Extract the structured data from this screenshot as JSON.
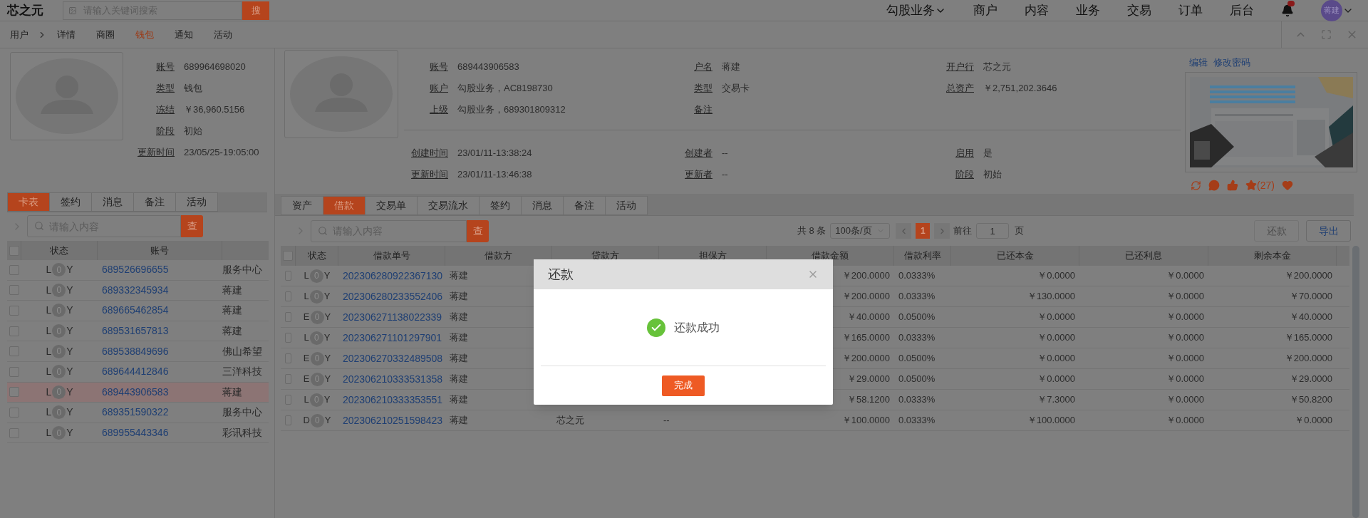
{
  "top_bar": {
    "logo": "芯之元",
    "search": {
      "placeholder": "请输入关键词搜索",
      "button": "搜"
    },
    "nav": [
      {
        "label": "勾股业务",
        "dropdown": true
      },
      {
        "label": "商户",
        "dropdown": false
      },
      {
        "label": "内容",
        "dropdown": false
      },
      {
        "label": "业务",
        "dropdown": false
      },
      {
        "label": "交易",
        "dropdown": false
      },
      {
        "label": "订单",
        "dropdown": false
      },
      {
        "label": "后台",
        "dropdown": false
      }
    ],
    "user": {
      "avatar": "蒋建"
    }
  },
  "breadcrumb": {
    "root": "用户",
    "tabs": [
      {
        "label": "详情",
        "selected": false
      },
      {
        "label": "商圈",
        "selected": false
      },
      {
        "label": "钱包",
        "selected": true
      },
      {
        "label": "通知",
        "selected": false
      },
      {
        "label": "活动",
        "selected": false
      }
    ]
  },
  "wallet": {
    "fields": [
      {
        "label": "账号",
        "value": "689964698020"
      },
      {
        "label": "类型",
        "value": "钱包"
      },
      {
        "label": "冻结",
        "value": "￥36,960.5156"
      },
      {
        "label": "阶段",
        "value": "初始"
      },
      {
        "label": "更新时间",
        "value": "23/05/25-19:05:00"
      }
    ]
  },
  "left_tabs": [
    {
      "label": "卡表",
      "selected": true
    },
    {
      "label": "签约",
      "selected": false
    },
    {
      "label": "消息",
      "selected": false
    },
    {
      "label": "备注",
      "selected": false
    },
    {
      "label": "活动",
      "selected": false
    }
  ],
  "left_search": {
    "placeholder": "请输入内容",
    "button": "查"
  },
  "left_table": {
    "all_checked": false,
    "columns": [
      "状态",
      "账号"
    ],
    "rows": [
      {
        "status": {
          "prefix": "L",
          "count": "0",
          "suffix": "Y"
        },
        "account": "689526696655",
        "column_3": "服务中心",
        "checked": false,
        "selected": false
      },
      {
        "status": {
          "prefix": "L",
          "count": "0",
          "suffix": "Y"
        },
        "account": "689332345934",
        "column_3": "蒋建",
        "checked": false,
        "selected": false
      },
      {
        "status": {
          "prefix": "L",
          "count": "0",
          "suffix": "Y"
        },
        "account": "689665462854",
        "column_3": "蒋建",
        "checked": false,
        "selected": false
      },
      {
        "status": {
          "prefix": "L",
          "count": "0",
          "suffix": "Y"
        },
        "account": "689531657813",
        "column_3": "蒋建",
        "checked": false,
        "selected": false
      },
      {
        "status": {
          "prefix": "L",
          "count": "0",
          "suffix": "Y"
        },
        "account": "689538849696",
        "column_3": "佛山希望",
        "checked": false,
        "selected": false
      },
      {
        "status": {
          "prefix": "L",
          "count": "0",
          "suffix": "Y"
        },
        "account": "689644412846",
        "column_3": "三洋科技",
        "checked": false,
        "selected": false
      },
      {
        "status": {
          "prefix": "L",
          "count": "0",
          "suffix": "Y"
        },
        "account": "689443906583",
        "column_3": "蒋建",
        "checked": false,
        "selected": true
      },
      {
        "status": {
          "prefix": "L",
          "count": "0",
          "suffix": "Y"
        },
        "account": "689351590322",
        "column_3": "服务中心",
        "checked": false,
        "selected": false
      },
      {
        "status": {
          "prefix": "L",
          "count": "0",
          "suffix": "Y"
        },
        "account": "689955443346",
        "column_3": "彩讯科技",
        "checked": false,
        "selected": false
      }
    ]
  },
  "card": {
    "sections": [
      [
        [
          {
            "label": "账号",
            "value": "689443906583"
          },
          {
            "label": "账户",
            "value": "勾股业务，AC8198730"
          },
          {
            "label": "上级",
            "value": "勾股业务，689301809312"
          }
        ],
        [
          {
            "label": "户名",
            "value": "蒋建"
          },
          {
            "label": "类型",
            "value": "交易卡"
          },
          {
            "label": "备注"
          }
        ],
        [
          {
            "label": "开户行",
            "value": "芯之元"
          },
          {
            "label": "总资产",
            "value": "￥2,751,202.3646"
          }
        ]
      ],
      [
        [
          {
            "label": "创建时间",
            "value": "23/01/11-13:38:24"
          },
          {
            "label": "更新时间",
            "value": "23/01/11-13:46:38"
          }
        ],
        [
          {
            "label": "创建者",
            "value": "--"
          },
          {
            "label": "更新者",
            "value": "--"
          }
        ],
        [
          {
            "label": "启用",
            "value": "是"
          },
          {
            "label": "阶段",
            "value": "初始"
          }
        ]
      ]
    ]
  },
  "card_actions": [
    "编辑",
    "修改密码"
  ],
  "reactions": {
    "star_count": "(27)"
  },
  "main_tabs": [
    {
      "label": "资产",
      "selected": false
    },
    {
      "label": "借款",
      "selected": true
    },
    {
      "label": "交易单",
      "selected": false
    },
    {
      "label": "交易流水",
      "selected": false
    },
    {
      "label": "签约",
      "selected": false
    },
    {
      "label": "消息",
      "selected": false
    },
    {
      "label": "备注",
      "selected": false
    },
    {
      "label": "活动",
      "selected": false
    }
  ],
  "loan_search": {
    "placeholder": "请输入内容",
    "button": "查"
  },
  "pagination": {
    "total": "共 8 条",
    "page_size": "100条/页",
    "pages": [
      {
        "label": "1",
        "selected": true
      }
    ],
    "goto_label": "前往",
    "goto_value": "1",
    "goto_suffix": "页"
  },
  "buttons": [
    {
      "label": "还款",
      "disabled": true
    },
    {
      "label": "导出",
      "disabled": false
    }
  ],
  "loan_table": {
    "all_checked": false,
    "columns": [
      "状态",
      "借款单号",
      "借款方",
      "贷款方",
      "担保方",
      "借款金额",
      "借款利率",
      "已还本金",
      "已还利息",
      "剩余本金"
    ],
    "rows": [
      {
        "status": {
          "prefix": "L",
          "count": "0",
          "suffix": "Y"
        },
        "id": "202306280922367130",
        "borrower": "蒋建",
        "amount": "￥200.0000",
        "rate": "0.0333%",
        "repaid_principal": "￥0.0000",
        "repaid_interest": "￥0.0000",
        "remaining": "￥200.0000",
        "checked": false
      },
      {
        "status": {
          "prefix": "L",
          "count": "0",
          "suffix": "Y"
        },
        "id": "202306280233552406",
        "borrower": "蒋建",
        "amount": "￥200.0000",
        "rate": "0.0333%",
        "repaid_principal": "￥130.0000",
        "repaid_interest": "￥0.0000",
        "remaining": "￥70.0000",
        "checked": false
      },
      {
        "status": {
          "prefix": "E",
          "count": "0",
          "suffix": "Y"
        },
        "id": "202306271138022339",
        "borrower": "蒋建",
        "amount": "￥40.0000",
        "rate": "0.0500%",
        "repaid_principal": "￥0.0000",
        "repaid_interest": "￥0.0000",
        "remaining": "￥40.0000",
        "checked": false
      },
      {
        "status": {
          "prefix": "L",
          "count": "0",
          "suffix": "Y"
        },
        "id": "202306271101297901",
        "borrower": "蒋建",
        "amount": "￥165.0000",
        "rate": "0.0333%",
        "repaid_principal": "￥0.0000",
        "repaid_interest": "￥0.0000",
        "remaining": "￥165.0000",
        "checked": false
      },
      {
        "status": {
          "prefix": "E",
          "count": "0",
          "suffix": "Y"
        },
        "id": "202306270332489508",
        "borrower": "蒋建",
        "amount": "￥200.0000",
        "rate": "0.0500%",
        "repaid_principal": "￥0.0000",
        "repaid_interest": "￥0.0000",
        "remaining": "￥200.0000",
        "checked": false
      },
      {
        "status": {
          "prefix": "E",
          "count": "0",
          "suffix": "Y"
        },
        "id": "202306210333531358",
        "borrower": "蒋建",
        "amount": "￥29.0000",
        "rate": "0.0500%",
        "repaid_principal": "￥0.0000",
        "repaid_interest": "￥0.0000",
        "remaining": "￥29.0000",
        "checked": false
      },
      {
        "status": {
          "prefix": "L",
          "count": "0",
          "suffix": "Y"
        },
        "id": "202306210333353551",
        "borrower": "蒋建",
        "amount": "￥58.1200",
        "rate": "0.0333%",
        "repaid_principal": "￥7.3000",
        "repaid_interest": "￥0.0000",
        "remaining": "￥50.8200",
        "checked": false
      },
      {
        "status": {
          "prefix": "D",
          "count": "0",
          "suffix": "Y"
        },
        "id": "202306210251598423",
        "borrower": "蒋建",
        "lender": "芯之元",
        "guarantor": "--",
        "amount": "￥100.0000",
        "rate": "0.0333%",
        "repaid_principal": "￥100.0000",
        "repaid_interest": "￥0.0000",
        "remaining": "￥0.0000",
        "checked": false
      }
    ]
  },
  "modal": {
    "title": "还款",
    "message": "还款成功",
    "button": "完成"
  }
}
